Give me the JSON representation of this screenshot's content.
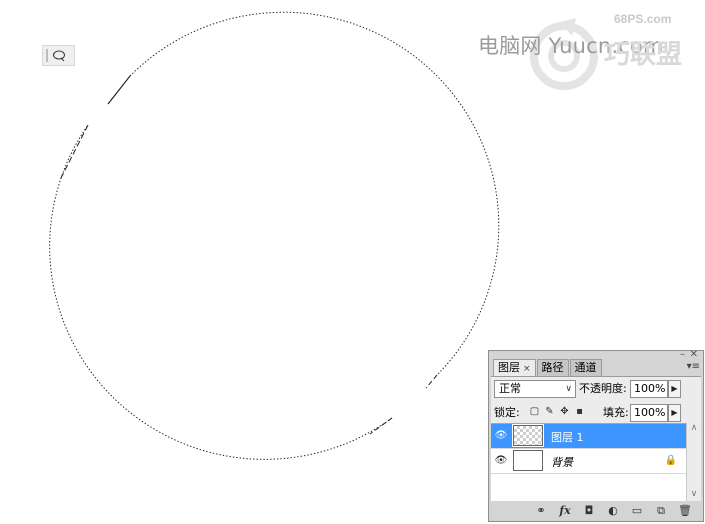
{
  "watermark": {
    "site": "68PS.com",
    "text": "电脑网 Yuucn.com",
    "brand": "巧联盟"
  },
  "tool": {
    "icon": "lasso-icon"
  },
  "layers_panel": {
    "tabs": [
      {
        "label": "图层",
        "close": "×",
        "active": true
      },
      {
        "label": "路径",
        "active": false
      },
      {
        "label": "通道",
        "active": false
      }
    ],
    "blend_mode": "正常",
    "opacity_label": "不透明度:",
    "opacity_value": "100%",
    "lock_label": "锁定:",
    "fill_label": "填充:",
    "fill_value": "100%",
    "layers": [
      {
        "name": "图层 1",
        "selected": true,
        "thumb": "transparent"
      },
      {
        "name": "背景",
        "selected": false,
        "thumb": "white",
        "locked": true
      }
    ]
  },
  "colors": {
    "selection": "#3d95ff",
    "panel": "#d4d4d4"
  }
}
